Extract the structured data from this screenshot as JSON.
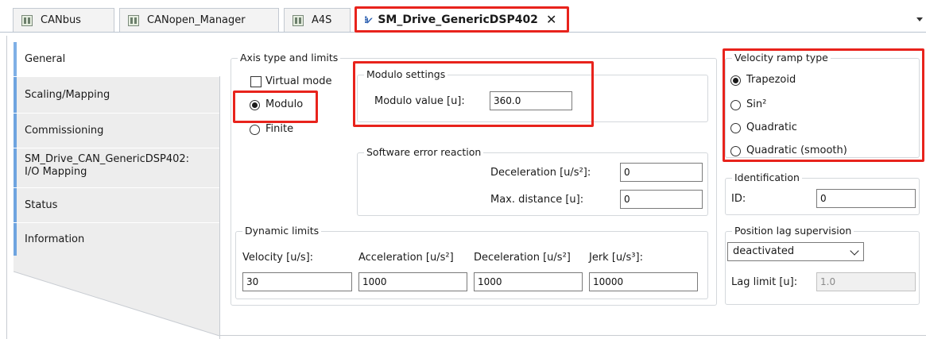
{
  "tabs": [
    {
      "label": "CANbus",
      "icon": "device-icon"
    },
    {
      "label": "CANopen_Manager",
      "icon": "device-icon"
    },
    {
      "label": "A4S",
      "icon": "device-icon"
    },
    {
      "label": "SM_Drive_GenericDSP402",
      "icon": "drive-icon",
      "active": true,
      "close": "✕"
    }
  ],
  "nav": {
    "items": [
      {
        "label": "General"
      },
      {
        "label": "Scaling/Mapping"
      },
      {
        "label": "Commissioning"
      },
      {
        "label": "SM_Drive_CAN_GenericDSP402:",
        "label2": "I/O Mapping"
      },
      {
        "label": "Status"
      },
      {
        "label": "Information"
      }
    ]
  },
  "axis": {
    "title": "Axis type and limits",
    "virtual_mode": "Virtual mode",
    "modulo": "Modulo",
    "finite": "Finite",
    "selected": "Modulo"
  },
  "modulo_settings": {
    "title": "Modulo settings",
    "label": "Modulo value [u]:",
    "value": "360.0"
  },
  "software_error": {
    "title": "Software error reaction",
    "decel_label": "Deceleration [u/s²]:",
    "decel_value": "0",
    "maxdist_label": "Max. distance [u]:",
    "maxdist_value": "0"
  },
  "dynamic_limits": {
    "title": "Dynamic limits",
    "velocity_label": "Velocity [u/s]:",
    "velocity_value": "30",
    "accel_label": "Acceleration [u/s²]",
    "accel_value": "1000",
    "decel_label": "Deceleration [u/s²]",
    "decel_value": "1000",
    "jerk_label": "Jerk [u/s³]:",
    "jerk_value": "10000"
  },
  "velocity_ramp": {
    "title": "Velocity ramp type",
    "options": [
      "Trapezoid",
      "Sin²",
      "Quadratic",
      "Quadratic (smooth)"
    ],
    "selected": "Trapezoid"
  },
  "identification": {
    "title": "Identification",
    "id_label": "ID:",
    "id_value": "0"
  },
  "position_lag": {
    "title": "Position lag supervision",
    "mode": "deactivated",
    "lag_label": "Lag limit [u]:",
    "lag_value": "1.0"
  },
  "colors": {
    "highlight": "#e8231c",
    "nav_accent": "#6ea4e0",
    "nav_bg": "#ededed"
  }
}
